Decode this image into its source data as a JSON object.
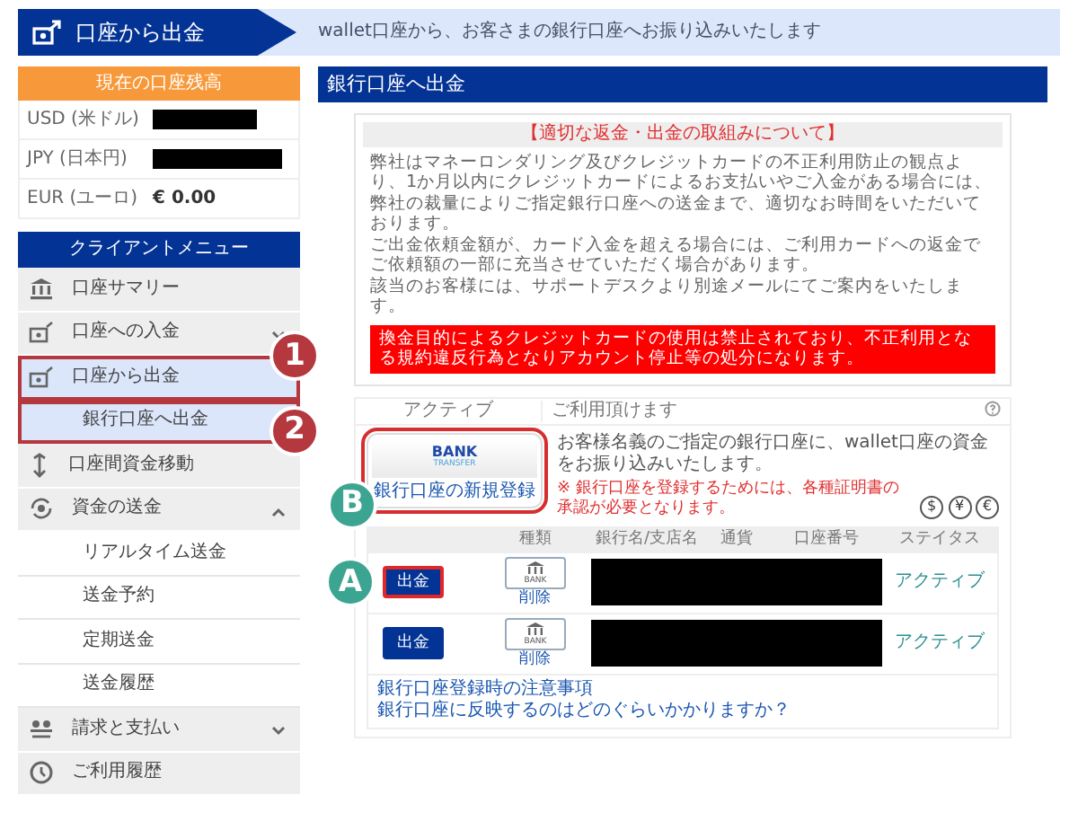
{
  "header": {
    "title": "口座から出金",
    "subtitle": "wallet口座から、お客さまの銀行口座へお振り込みいたします"
  },
  "balances": {
    "title": "現在の口座残高",
    "rows": [
      {
        "currency": "USD (米ドル)",
        "hidden": true
      },
      {
        "currency": "JPY (日本円)",
        "hidden": true
      },
      {
        "currency": "EUR (ユーロ)",
        "amount": "€ 0.00",
        "hidden": false
      }
    ]
  },
  "menu": {
    "title": "クライアントメニュー",
    "items": [
      {
        "label": "口座サマリー",
        "selected": false
      },
      {
        "label": "口座への入金",
        "selected": false,
        "expanded": false
      },
      {
        "label": "口座から出金",
        "selected": true,
        "highlighted": true,
        "callout": "1",
        "children": [
          {
            "label": "銀行口座へ出金",
            "selected": true,
            "highlighted": true,
            "callout": "2"
          }
        ]
      },
      {
        "label": "口座間資金移動",
        "selected": false
      },
      {
        "label": "資金の送金",
        "selected": false,
        "expanded": true,
        "children": [
          {
            "label": "リアルタイム送金",
            "selected": false
          },
          {
            "label": "送金予約",
            "selected": false
          },
          {
            "label": "定期送金",
            "selected": false
          },
          {
            "label": "送金履歴",
            "selected": false
          }
        ]
      },
      {
        "label": "請求と支払い",
        "selected": false,
        "expanded": false
      },
      {
        "label": "ご利用履歴",
        "selected": false
      }
    ]
  },
  "main": {
    "title": "銀行口座へ出金",
    "notice": {
      "title": "【適切な返金・出金の取組みについて】",
      "paragraphs": [
        "弊社はマネーロンダリング及びクレジットカードの不正利用防止の観点より、1か月以内にクレジットカードによるお支払いやご入金がある場合には、弊社の裁量によりご指定銀行口座への送金まで、適切なお時間をいただいております。",
        "ご出金依頼金額が、カード入金を超える場合には、ご利用カードへの返金でご依頼額の一部に充当させていただく場合があります。",
        "該当のお客様には、サポートデスクより別途メールにてご案内をいたします。"
      ],
      "warning": "換金目的によるクレジットカードの使用は禁止されており、不正利用となる規約違反行為となりアカウント停止等の処分になります。"
    },
    "method": {
      "status": "アクティブ",
      "availability": "ご利用頂けます",
      "logo": "BANK",
      "logo_sub": "TRANSFER",
      "register_link": "銀行口座の新規登録",
      "highlighted": true,
      "callout": "B",
      "description": "お客様名義のご指定の銀行口座に、wallet口座の資金をお振り込みいたします。",
      "note": "※ 銀行口座を登録するためには、各種証明書の承認が必要となります。",
      "currencies": [
        "$",
        "¥",
        "€"
      ]
    },
    "accounts": {
      "columns": [
        "種類",
        "銀行名/支店名",
        "通貨",
        "口座番号",
        "ステイタス"
      ],
      "rows": [
        {
          "button": "出金",
          "highlighted": true,
          "callout": "A",
          "icon_label": "BANK",
          "delete": "削除",
          "hidden": true,
          "status": "アクティブ"
        },
        {
          "button": "出金",
          "highlighted": false,
          "icon_label": "BANK",
          "delete": "削除",
          "hidden": true,
          "status": "アクティブ"
        }
      ]
    },
    "links": [
      "銀行口座登録時の注意事項",
      "銀行口座に反映するのはどのぐらいかかりますか？"
    ]
  }
}
